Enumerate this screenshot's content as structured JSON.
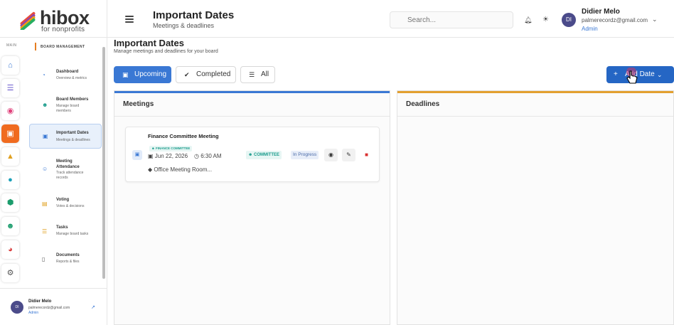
{
  "brand": {
    "name": "hibox",
    "tagline": "for nonprofits"
  },
  "header": {
    "title": "Important Dates",
    "subtitle": "Meetings & deadlines",
    "search_placeholder": "Search...",
    "user": {
      "name": "Didier Melo",
      "email": "palmerecordz@gmail.com",
      "role": "Admin",
      "initials": "DI"
    }
  },
  "rail": {
    "label": "MAIN",
    "icons": [
      "home-icon",
      "sitemap-icon",
      "pill-icon",
      "calendar-icon",
      "graduation-icon",
      "circle-icon",
      "network-icon",
      "users-icon",
      "pie-chart-icon",
      "gear-icon"
    ]
  },
  "panel": {
    "heading": "BOARD MANAGEMENT",
    "items": [
      {
        "title": "Dashboard",
        "desc": "Overview & metrics",
        "icon": "gauge-icon"
      },
      {
        "title": "Board Members",
        "desc": "Manage board members",
        "icon": "users-icon"
      },
      {
        "title": "Important Dates",
        "desc": "Meetings & deadlines",
        "icon": "calendar-icon",
        "active": true
      },
      {
        "title": "Meeting Attendance",
        "desc": "Track attendance records",
        "icon": "user-check-icon"
      },
      {
        "title": "Voting",
        "desc": "Votes & decisions",
        "icon": "vote-icon"
      },
      {
        "title": "Tasks",
        "desc": "Manage board tasks",
        "icon": "list-icon"
      },
      {
        "title": "Documents",
        "desc": "Reports & files",
        "icon": "file-icon"
      }
    ],
    "user": {
      "name": "Didier Melo",
      "email": "palmerecordz@gmail.com",
      "role": "Admin",
      "initials": "DI"
    }
  },
  "main": {
    "title": "Important Dates",
    "subtitle": "Manage meetings and deadlines for your board",
    "tabs": [
      {
        "label": "Upcoming",
        "active": true
      },
      {
        "label": "Completed",
        "active": false
      },
      {
        "label": "All",
        "active": false
      }
    ],
    "add_button": "Add Date",
    "columns": {
      "meetings": "Meetings",
      "deadlines": "Deadlines"
    },
    "meeting_card": {
      "title": "Finance Committee Meeting",
      "tag": "FINANCE COMMITTEE",
      "date": "Jun 22, 2026",
      "time": "6:30 AM",
      "location": "Office Meeting Room...",
      "type_badge": "COMMITTEE",
      "status_badge": "In Progress"
    }
  },
  "colors": {
    "primary": "#3a78d4",
    "accent_meetings": "#3a78d4",
    "accent_deadlines": "#e3a030",
    "teal": "#1b9c8c",
    "delete": "#d93030"
  }
}
